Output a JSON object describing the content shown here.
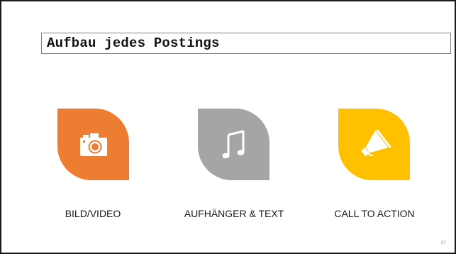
{
  "slide": {
    "title": "Aufbau jedes Postings",
    "page_number": "27"
  },
  "items": [
    {
      "label": "BILD/VIDEO",
      "icon": "camera-icon",
      "color": "#ED7D31"
    },
    {
      "label": "AUFHÄNGER & TEXT",
      "icon": "music-note-icon",
      "color": "#A5A5A5"
    },
    {
      "label": "CALL TO ACTION",
      "icon": "megaphone-icon",
      "color": "#FFC000"
    }
  ],
  "colors": {
    "border": "#1a1a1a",
    "title_box_border": "#7f7f7f",
    "icon_foreground": "#ffffff"
  }
}
